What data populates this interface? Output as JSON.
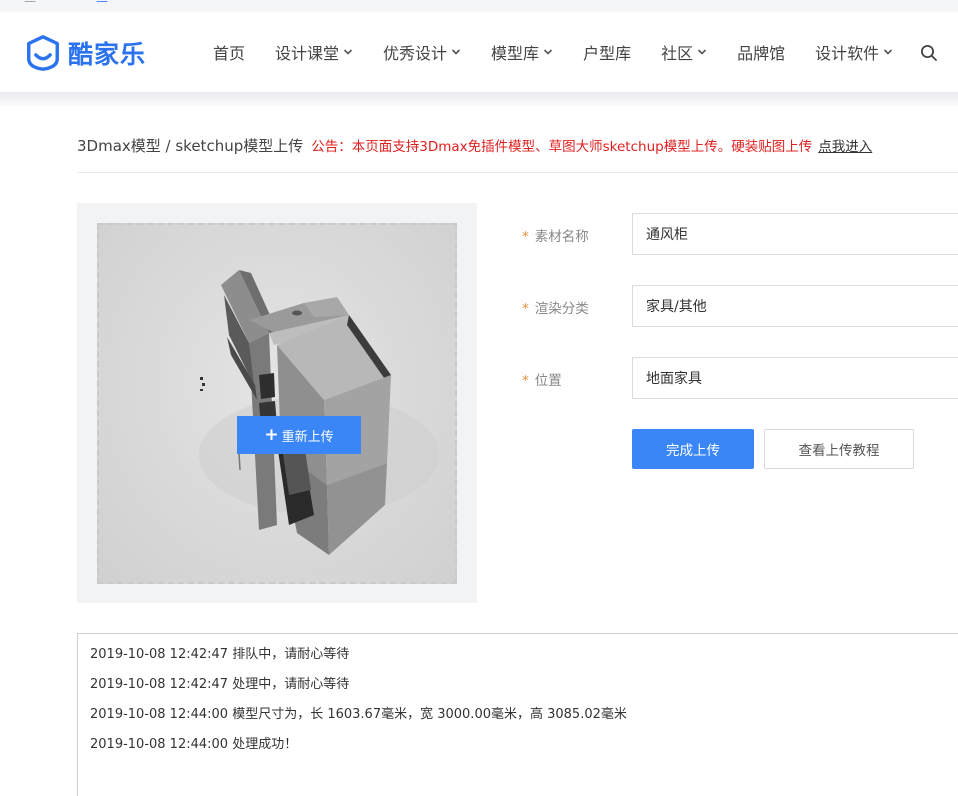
{
  "brand": {
    "name": "酷家乐",
    "color": "#2a72ee"
  },
  "nav": {
    "items": [
      {
        "label": "首页",
        "dropdown": false
      },
      {
        "label": "设计课堂",
        "dropdown": true
      },
      {
        "label": "优秀设计",
        "dropdown": true
      },
      {
        "label": "模型库",
        "dropdown": true
      },
      {
        "label": "户型库",
        "dropdown": false
      },
      {
        "label": "社区",
        "dropdown": true
      },
      {
        "label": "品牌馆",
        "dropdown": false
      },
      {
        "label": "设计软件",
        "dropdown": true
      }
    ],
    "search_icon": "search-icon"
  },
  "breadcrumb": {
    "title": "3Dmax模型 / sketchup模型上传",
    "notice": "公告：本页面支持3Dmax免插件模型、草图大师sketchup模型上传。硬装贴图上传",
    "notice_link": "点我进入"
  },
  "preview": {
    "reupload_label": "重新上传"
  },
  "form": {
    "required_mark": "*",
    "fields": [
      {
        "label": "素材名称",
        "value": "通风柜"
      },
      {
        "label": "渲染分类",
        "value": "家具/其他"
      },
      {
        "label": "位置",
        "value": "地面家具"
      }
    ],
    "submit_label": "完成上传",
    "tutorial_label": "查看上传教程"
  },
  "log": {
    "lines": [
      "2019-10-08 12:42:47 排队中，请耐心等待",
      "2019-10-08 12:42:47 处理中，请耐心等待",
      "2019-10-08 12:44:00 模型尺寸为，长 1603.67毫米，宽 3000.00毫米，高 3085.02毫米",
      "2019-10-08 12:44:00 处理成功！"
    ]
  },
  "colors": {
    "primary": "#3a86f7",
    "notice": "#e02020",
    "required": "#f08a3c"
  }
}
